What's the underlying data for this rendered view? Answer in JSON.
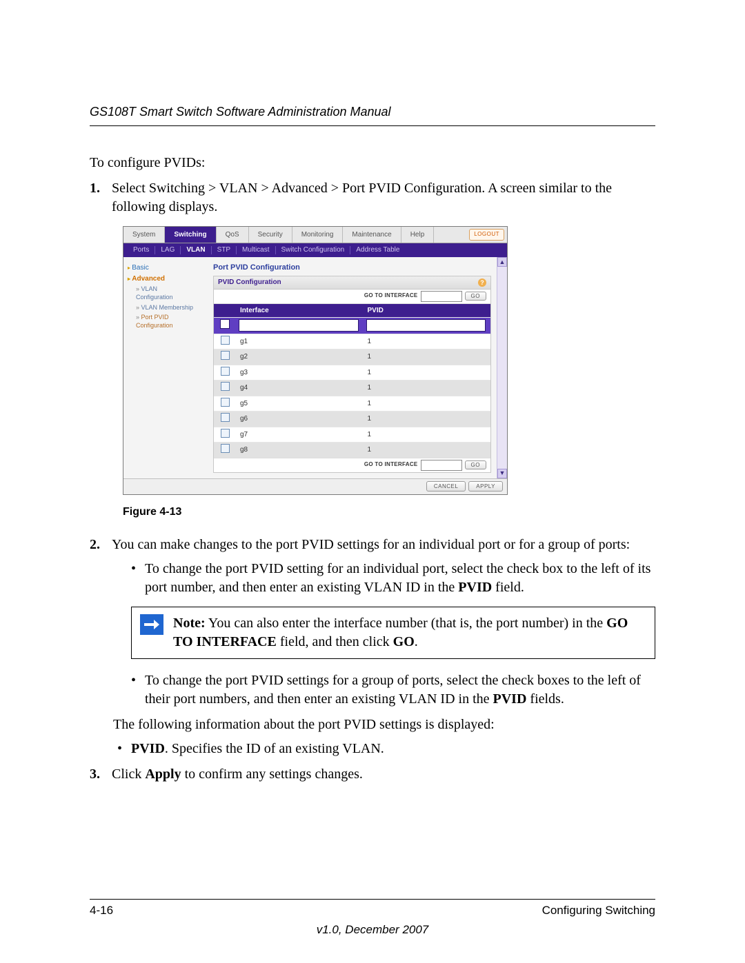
{
  "header": "GS108T Smart Switch Software Administration Manual",
  "intro": "To configure PVIDs:",
  "step1_num": "1.",
  "step1_text": "Select Switching > VLAN > Advanced > Port PVID Configuration. A screen similar to the following displays.",
  "figure_caption": "Figure 4-13",
  "step2_num": "2.",
  "step2_text": "You can make changes to the port PVID settings for an individual port or for a group of ports:",
  "bullet1a": "To change the port PVID setting for an individual port, select the check box to the left of its port number, and then enter an existing VLAN ID in the ",
  "bullet1b": "PVID",
  "bullet1c": " field.",
  "note_label": "Note:",
  "note_a": " You can also enter the interface number (that is, the port number) in the ",
  "note_b": "GO TO INTERFACE",
  "note_c": " field, and then click ",
  "note_d": "GO",
  "note_e": ".",
  "bullet2a": "To change the port PVID settings for a group of ports, select the check boxes to the left of their port numbers, and then enter an existing VLAN ID in the ",
  "bullet2b": "PVID",
  "bullet2c": " fields.",
  "info_line": "The following information about the port PVID settings is displayed:",
  "bullet3a": "PVID",
  "bullet3b": ". Specifies the ID of an existing VLAN.",
  "step3_num": "3.",
  "step3a": "Click ",
  "step3b": "Apply",
  "step3c": " to confirm any settings changes.",
  "footer_page": "4-16",
  "footer_section": "Configuring Switching",
  "footer_version": "v1.0, December 2007",
  "shot": {
    "tabs": [
      "System",
      "Switching",
      "QoS",
      "Security",
      "Monitoring",
      "Maintenance",
      "Help"
    ],
    "active_tab": "Switching",
    "logout": "LOGOUT",
    "subtabs": [
      "Ports",
      "LAG",
      "VLAN",
      "STP",
      "Multicast",
      "Switch Configuration",
      "Address Table"
    ],
    "active_subtab": "VLAN",
    "side": {
      "basic": "Basic",
      "advanced": "Advanced",
      "vlan_cfg1": "VLAN",
      "vlan_cfg2": "Configuration",
      "vlan_mem": "VLAN Membership",
      "port_pvid1": "Port PVID",
      "port_pvid2": "Configuration"
    },
    "panel_title": "Port PVID Configuration",
    "panel_head": "PVID Configuration",
    "go_label": "GO TO INTERFACE",
    "go_btn": "GO",
    "col_interface": "Interface",
    "col_pvid": "PVID",
    "rows": [
      {
        "if": "g1",
        "pvid": "1"
      },
      {
        "if": "g2",
        "pvid": "1"
      },
      {
        "if": "g3",
        "pvid": "1"
      },
      {
        "if": "g4",
        "pvid": "1"
      },
      {
        "if": "g5",
        "pvid": "1"
      },
      {
        "if": "g6",
        "pvid": "1"
      },
      {
        "if": "g7",
        "pvid": "1"
      },
      {
        "if": "g8",
        "pvid": "1"
      }
    ],
    "footer_cancel": "CANCEL",
    "footer_apply": "APPLY"
  }
}
